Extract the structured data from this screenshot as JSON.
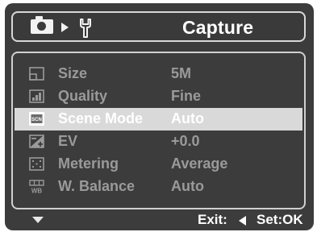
{
  "header": {
    "camera_icon": "camera-icon",
    "arrow_icon": "play-arrow-icon",
    "wrench_icon": "wrench-icon",
    "title": "Capture"
  },
  "menu": {
    "selected_index": 2,
    "items": [
      {
        "icon": "size-icon",
        "label": "Size",
        "value": "5M"
      },
      {
        "icon": "quality-icon",
        "label": "Quality",
        "value": "Fine"
      },
      {
        "icon": "scene-mode-icon",
        "label": "Scene Mode",
        "value": "Auto"
      },
      {
        "icon": "ev-icon",
        "label": "EV",
        "value": "+0.0"
      },
      {
        "icon": "metering-icon",
        "label": "Metering",
        "value": "Average"
      },
      {
        "icon": "white-balance-icon",
        "label": "W. Balance",
        "value": "Auto"
      }
    ]
  },
  "footer": {
    "more_icon": "scroll-down-icon",
    "exit_label": "Exit:",
    "exit_icon": "left-arrow-icon",
    "set_label": "Set:OK"
  },
  "colors": {
    "background": "#3c3c3c",
    "highlight": "#d9d9d9",
    "inactive_text": "#9a9a9a",
    "active_text": "#ffffff"
  }
}
